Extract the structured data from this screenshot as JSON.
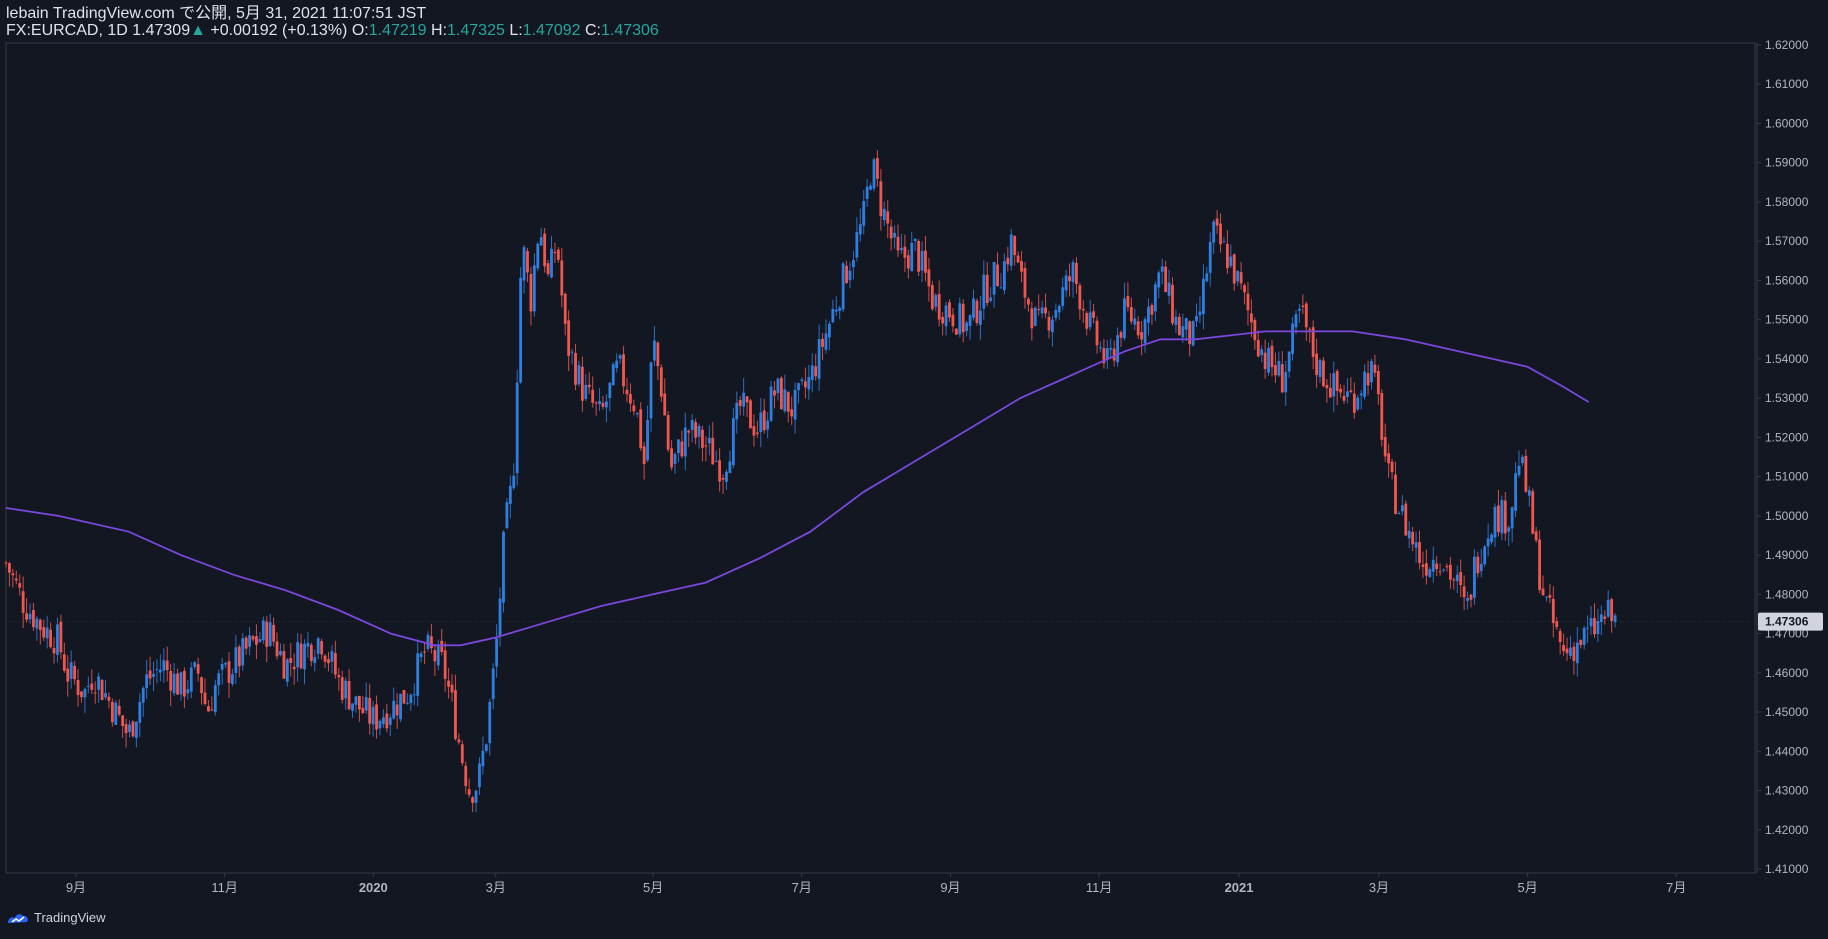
{
  "header": {
    "published": "lebain TradingView.com で公開, 5月 31, 2021 11:07:51 JST",
    "symbol": "FX:EURCAD, 1D",
    "last": "1.47309",
    "arrow": "▲",
    "change": "+0.00192 (+0.13%)",
    "o_label": "O:",
    "o": "1.47219",
    "h_label": "H:",
    "h": "1.47325",
    "l_label": "L:",
    "l": "1.47092",
    "c_label": "C:",
    "c": "1.47306"
  },
  "footer": {
    "brand": "TradingView"
  },
  "colors": {
    "background": "#131722",
    "up": "#2f7fe0",
    "down": "#f0584f",
    "ma": "#7b47dc",
    "axis_text": "#b2b5be",
    "price_tag_bg": "#d1d4dc"
  },
  "chart_data": {
    "type": "candlestick",
    "symbol": "FX:EURCAD",
    "interval": "1D",
    "y_ticks": [
      "1.41000",
      "1.42000",
      "1.43000",
      "1.44000",
      "1.45000",
      "1.46000",
      "1.47000",
      "1.48000",
      "1.49000",
      "1.50000",
      "1.51000",
      "1.52000",
      "1.53000",
      "1.54000",
      "1.55000",
      "1.56000",
      "1.57000",
      "1.58000",
      "1.59000",
      "1.60000",
      "1.61000",
      "1.62000"
    ],
    "ylim": [
      1.41,
      1.62
    ],
    "x_ticks": [
      {
        "label": "9月",
        "t": 0.04
      },
      {
        "label": "11月",
        "t": 0.125
      },
      {
        "label": "2020",
        "t": 0.21,
        "bold": true
      },
      {
        "label": "3月",
        "t": 0.28
      },
      {
        "label": "5月",
        "t": 0.37
      },
      {
        "label": "7月",
        "t": 0.455
      },
      {
        "label": "9月",
        "t": 0.54
      },
      {
        "label": "11月",
        "t": 0.625
      },
      {
        "label": "2021",
        "t": 0.705,
        "bold": true
      },
      {
        "label": "3月",
        "t": 0.785
      },
      {
        "label": "5月",
        "t": 0.87
      },
      {
        "label": "7月",
        "t": 0.955
      }
    ],
    "last_price": 1.47306,
    "last_price_label": "1.47306",
    "candle_path": [
      [
        0,
        1.488
      ],
      [
        0.01,
        1.478
      ],
      [
        0.02,
        1.472
      ],
      [
        0.03,
        1.468
      ],
      [
        0.035,
        1.46
      ],
      [
        0.045,
        1.455
      ],
      [
        0.05,
        1.46
      ],
      [
        0.06,
        1.452
      ],
      [
        0.07,
        1.444
      ],
      [
        0.08,
        1.458
      ],
      [
        0.09,
        1.462
      ],
      [
        0.1,
        1.456
      ],
      [
        0.11,
        1.46
      ],
      [
        0.115,
        1.45
      ],
      [
        0.12,
        1.457
      ],
      [
        0.13,
        1.462
      ],
      [
        0.14,
        1.467
      ],
      [
        0.15,
        1.471
      ],
      [
        0.16,
        1.462
      ],
      [
        0.17,
        1.466
      ],
      [
        0.18,
        1.469
      ],
      [
        0.19,
        1.458
      ],
      [
        0.2,
        1.452
      ],
      [
        0.21,
        1.448
      ],
      [
        0.22,
        1.451
      ],
      [
        0.23,
        1.455
      ],
      [
        0.24,
        1.466
      ],
      [
        0.25,
        1.462
      ],
      [
        0.255,
        1.452
      ],
      [
        0.26,
        1.44
      ],
      [
        0.265,
        1.43
      ],
      [
        0.27,
        1.432
      ],
      [
        0.275,
        1.445
      ],
      [
        0.28,
        1.465
      ],
      [
        0.285,
        1.495
      ],
      [
        0.29,
        1.51
      ],
      [
        0.295,
        1.57
      ],
      [
        0.3,
        1.555
      ],
      [
        0.305,
        1.575
      ],
      [
        0.31,
        1.56
      ],
      [
        0.315,
        1.57
      ],
      [
        0.32,
        1.545
      ],
      [
        0.33,
        1.532
      ],
      [
        0.34,
        1.525
      ],
      [
        0.35,
        1.538
      ],
      [
        0.36,
        1.528
      ],
      [
        0.365,
        1.513
      ],
      [
        0.37,
        1.545
      ],
      [
        0.375,
        1.532
      ],
      [
        0.38,
        1.512
      ],
      [
        0.39,
        1.522
      ],
      [
        0.4,
        1.518
      ],
      [
        0.41,
        1.512
      ],
      [
        0.42,
        1.528
      ],
      [
        0.43,
        1.522
      ],
      [
        0.44,
        1.532
      ],
      [
        0.45,
        1.527
      ],
      [
        0.46,
        1.535
      ],
      [
        0.47,
        1.548
      ],
      [
        0.48,
        1.562
      ],
      [
        0.49,
        1.575
      ],
      [
        0.495,
        1.59
      ],
      [
        0.5,
        1.58
      ],
      [
        0.51,
        1.565
      ],
      [
        0.52,
        1.568
      ],
      [
        0.53,
        1.555
      ],
      [
        0.54,
        1.552
      ],
      [
        0.55,
        1.548
      ],
      [
        0.56,
        1.558
      ],
      [
        0.57,
        1.563
      ],
      [
        0.575,
        1.57
      ],
      [
        0.58,
        1.56
      ],
      [
        0.59,
        1.548
      ],
      [
        0.6,
        1.553
      ],
      [
        0.61,
        1.562
      ],
      [
        0.62,
        1.548
      ],
      [
        0.63,
        1.538
      ],
      [
        0.64,
        1.552
      ],
      [
        0.65,
        1.548
      ],
      [
        0.66,
        1.562
      ],
      [
        0.67,
        1.548
      ],
      [
        0.68,
        1.545
      ],
      [
        0.69,
        1.572
      ],
      [
        0.7,
        1.565
      ],
      [
        0.71,
        1.552
      ],
      [
        0.72,
        1.54
      ],
      [
        0.73,
        1.535
      ],
      [
        0.74,
        1.552
      ],
      [
        0.75,
        1.538
      ],
      [
        0.76,
        1.532
      ],
      [
        0.77,
        1.53
      ],
      [
        0.78,
        1.538
      ],
      [
        0.785,
        1.528
      ],
      [
        0.79,
        1.51
      ],
      [
        0.8,
        1.498
      ],
      [
        0.81,
        1.488
      ],
      [
        0.82,
        1.49
      ],
      [
        0.83,
        1.482
      ],
      [
        0.835,
        1.475
      ],
      [
        0.84,
        1.488
      ],
      [
        0.85,
        1.5
      ],
      [
        0.86,
        1.5
      ],
      [
        0.865,
        1.515
      ],
      [
        0.87,
        1.505
      ],
      [
        0.875,
        1.49
      ],
      [
        0.88,
        1.478
      ],
      [
        0.885,
        1.472
      ],
      [
        0.89,
        1.465
      ],
      [
        0.9,
        1.468
      ],
      [
        0.91,
        1.472
      ],
      [
        0.915,
        1.475
      ],
      [
        0.92,
        1.473
      ]
    ],
    "ma_line": [
      [
        0,
        1.502
      ],
      [
        0.03,
        1.5
      ],
      [
        0.07,
        1.496
      ],
      [
        0.1,
        1.49
      ],
      [
        0.13,
        1.485
      ],
      [
        0.16,
        1.481
      ],
      [
        0.19,
        1.476
      ],
      [
        0.22,
        1.47
      ],
      [
        0.245,
        1.467
      ],
      [
        0.26,
        1.467
      ],
      [
        0.28,
        1.469
      ],
      [
        0.31,
        1.473
      ],
      [
        0.34,
        1.477
      ],
      [
        0.37,
        1.48
      ],
      [
        0.4,
        1.483
      ],
      [
        0.43,
        1.489
      ],
      [
        0.46,
        1.496
      ],
      [
        0.49,
        1.506
      ],
      [
        0.52,
        1.514
      ],
      [
        0.55,
        1.522
      ],
      [
        0.58,
        1.53
      ],
      [
        0.61,
        1.536
      ],
      [
        0.64,
        1.542
      ],
      [
        0.66,
        1.545
      ],
      [
        0.68,
        1.545
      ],
      [
        0.7,
        1.546
      ],
      [
        0.72,
        1.547
      ],
      [
        0.74,
        1.547
      ],
      [
        0.77,
        1.547
      ],
      [
        0.8,
        1.545
      ],
      [
        0.83,
        1.542
      ],
      [
        0.85,
        1.54
      ],
      [
        0.87,
        1.538
      ],
      [
        0.89,
        1.533
      ],
      [
        0.905,
        1.529
      ]
    ]
  }
}
